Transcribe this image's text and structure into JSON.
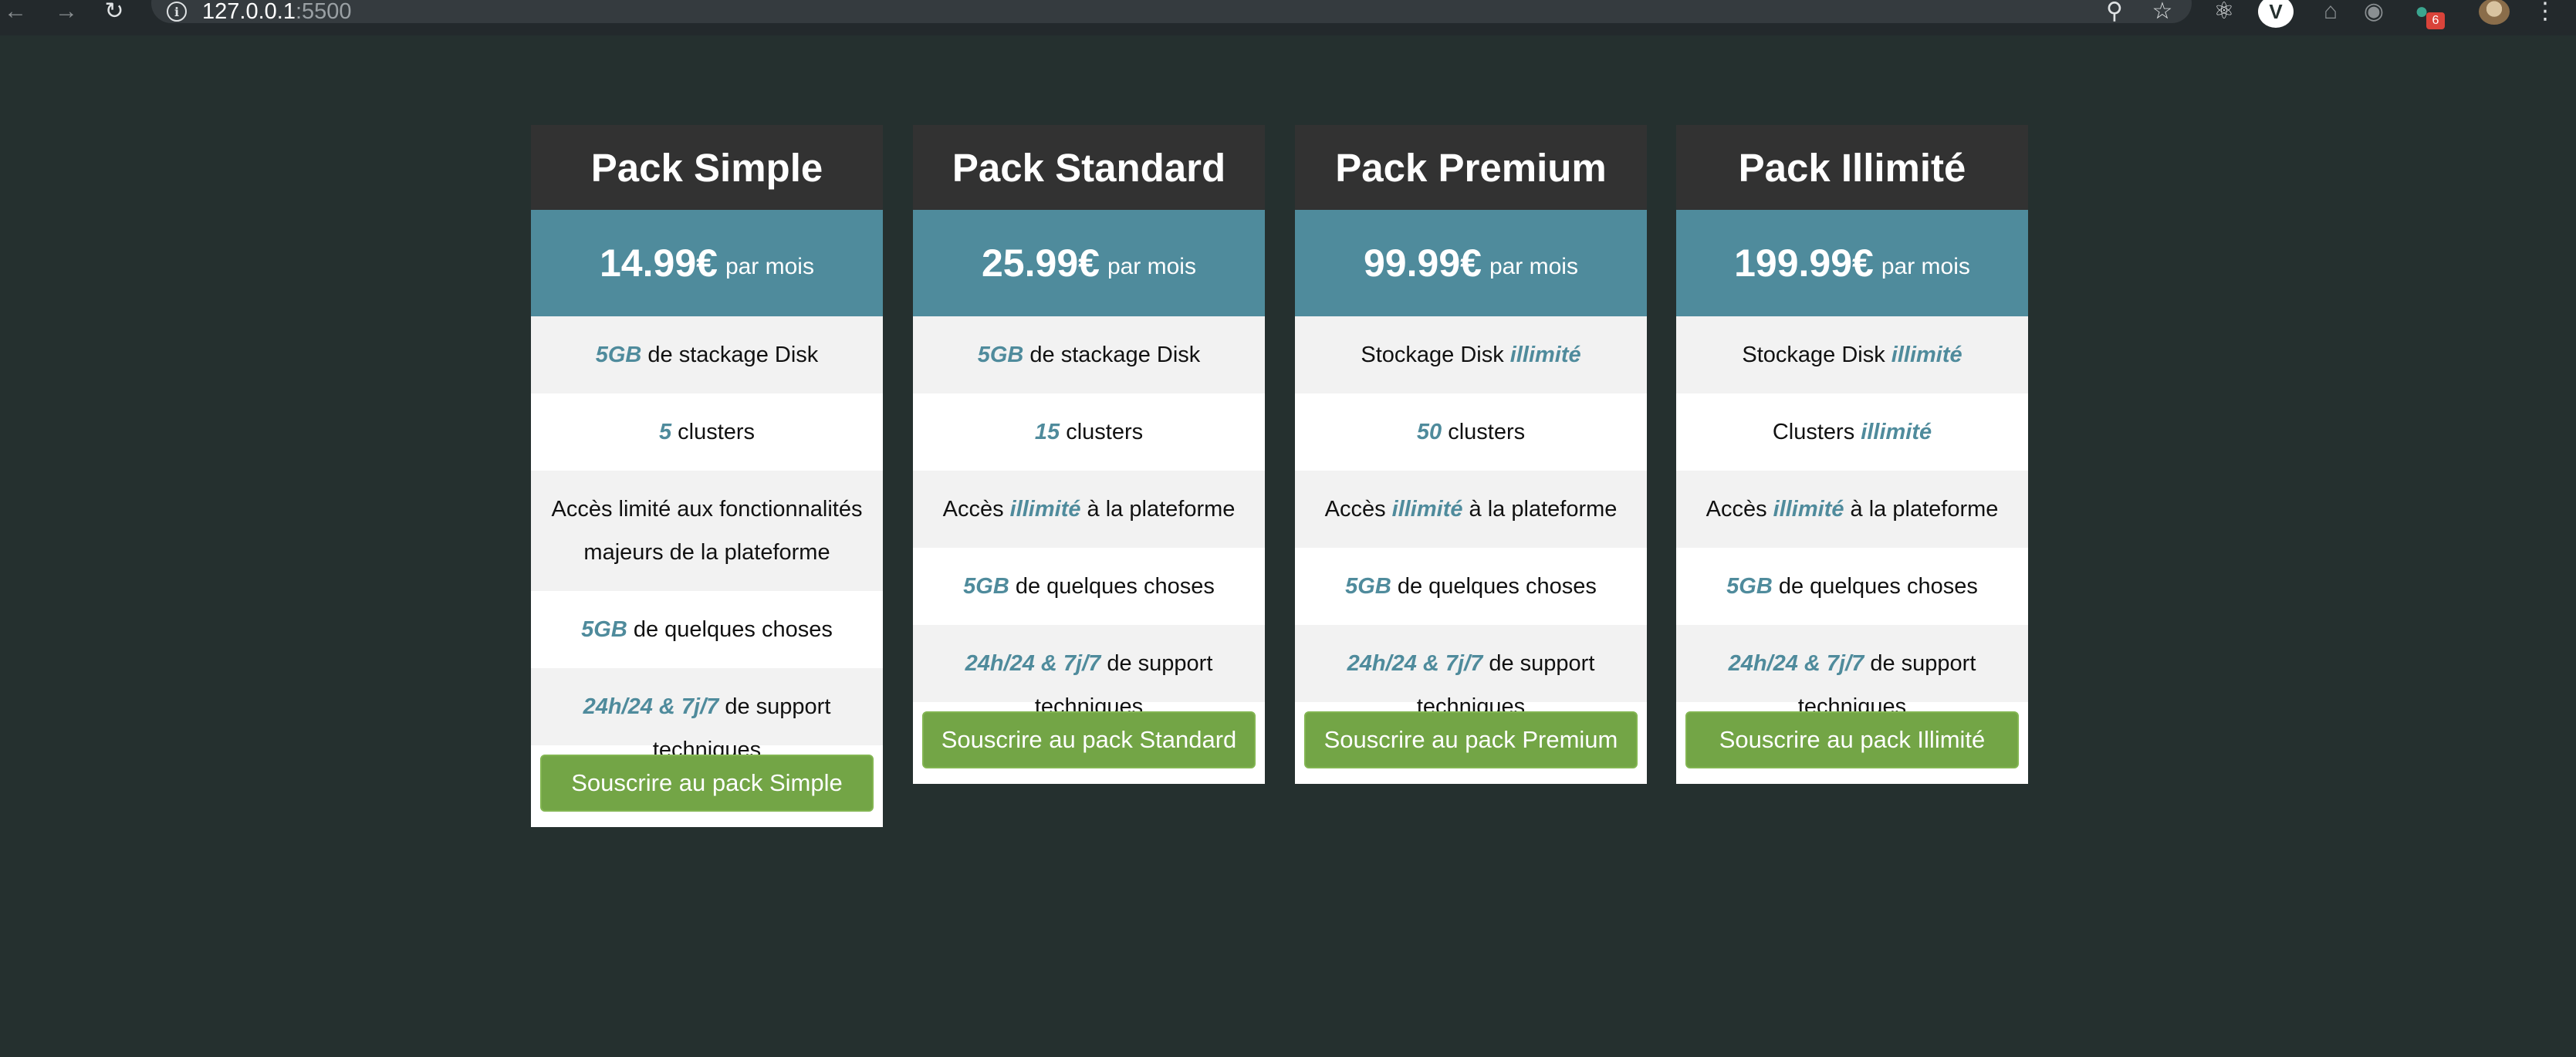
{
  "browser": {
    "url_host": "127.0.0.1",
    "url_port": ":5500",
    "extension_badge": "6",
    "icons": [
      "back-arrow-icon",
      "forward-arrow-icon",
      "reload-icon",
      "info-icon",
      "zoom-icon",
      "bookmark-star-icon",
      "react-devtools-icon",
      "vivaldi-icon",
      "home-icon",
      "extension-icon",
      "extension-badge-icon",
      "profile-avatar",
      "menu-kebab-icon"
    ]
  },
  "colors": {
    "page_background": "#25302f",
    "card_header": "#323232",
    "price_band": "#4f8b9c",
    "highlight": "#4f8b9c",
    "cta_button": "#73a546",
    "row_alt": "#f2f2f2"
  },
  "period": "par mois",
  "plans": [
    {
      "title": "Pack Simple",
      "price": "14.99€",
      "features": [
        {
          "parts": [
            {
              "t": "5GB",
              "hl": true
            },
            {
              "t": " de stackage Disk"
            }
          ]
        },
        {
          "parts": [
            {
              "t": "5",
              "hl": true
            },
            {
              "t": " clusters"
            }
          ]
        },
        {
          "parts": [
            {
              "t": "Accès limité aux fonctionnalités majeurs de la plateforme"
            }
          ]
        },
        {
          "parts": [
            {
              "t": "5GB",
              "hl": true
            },
            {
              "t": " de quelques choses"
            }
          ]
        },
        {
          "parts": [
            {
              "t": "24h/24 & 7j/7",
              "hl": true
            },
            {
              "t": " de support techniques"
            }
          ]
        }
      ],
      "button": "Souscrire au pack Simple"
    },
    {
      "title": "Pack Standard",
      "price": "25.99€",
      "features": [
        {
          "parts": [
            {
              "t": "5GB",
              "hl": true
            },
            {
              "t": " de stackage Disk"
            }
          ]
        },
        {
          "parts": [
            {
              "t": "15",
              "hl": true
            },
            {
              "t": " clusters"
            }
          ]
        },
        {
          "parts": [
            {
              "t": "Accès "
            },
            {
              "t": "illimité",
              "hl": true
            },
            {
              "t": " à la plateforme"
            }
          ]
        },
        {
          "parts": [
            {
              "t": "5GB",
              "hl": true
            },
            {
              "t": " de quelques choses"
            }
          ]
        },
        {
          "parts": [
            {
              "t": "24h/24 & 7j/7",
              "hl": true
            },
            {
              "t": " de support techniques"
            }
          ]
        }
      ],
      "button": "Souscrire au pack Standard"
    },
    {
      "title": "Pack Premium",
      "price": "99.99€",
      "features": [
        {
          "parts": [
            {
              "t": "Stockage Disk "
            },
            {
              "t": "illimité",
              "hl": true
            }
          ]
        },
        {
          "parts": [
            {
              "t": "50",
              "hl": true
            },
            {
              "t": " clusters"
            }
          ]
        },
        {
          "parts": [
            {
              "t": "Accès "
            },
            {
              "t": "illimité",
              "hl": true
            },
            {
              "t": " à la plateforme"
            }
          ]
        },
        {
          "parts": [
            {
              "t": "5GB",
              "hl": true
            },
            {
              "t": " de quelques choses"
            }
          ]
        },
        {
          "parts": [
            {
              "t": "24h/24 & 7j/7",
              "hl": true
            },
            {
              "t": " de support techniques"
            }
          ]
        }
      ],
      "button": "Souscrire au pack Premium"
    },
    {
      "title": "Pack Illimité",
      "price": "199.99€",
      "features": [
        {
          "parts": [
            {
              "t": "Stockage Disk "
            },
            {
              "t": "illimité",
              "hl": true
            }
          ]
        },
        {
          "parts": [
            {
              "t": "Clusters "
            },
            {
              "t": "illimité",
              "hl": true
            }
          ]
        },
        {
          "parts": [
            {
              "t": "Accès "
            },
            {
              "t": "illimité",
              "hl": true
            },
            {
              "t": " à la plateforme"
            }
          ]
        },
        {
          "parts": [
            {
              "t": "5GB",
              "hl": true
            },
            {
              "t": " de quelques choses"
            }
          ]
        },
        {
          "parts": [
            {
              "t": "24h/24 & 7j/7",
              "hl": true
            },
            {
              "t": " de support techniques"
            }
          ]
        }
      ],
      "button": "Souscrire au pack Illimité"
    }
  ]
}
